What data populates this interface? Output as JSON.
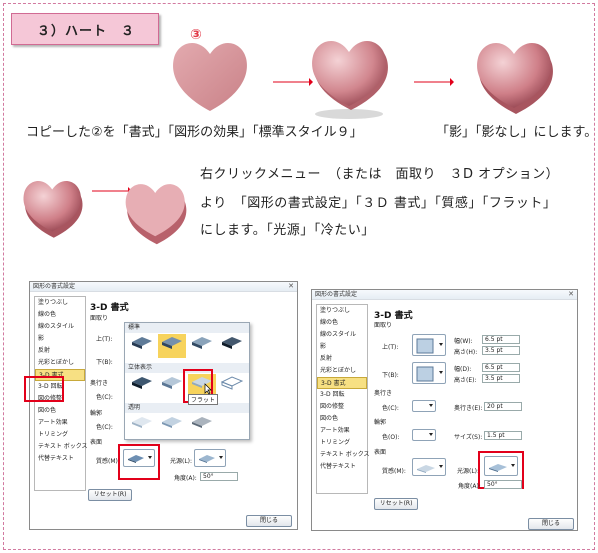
{
  "header": {
    "title": "３）ハート　３"
  },
  "step_marker": "③",
  "captions": {
    "copy": "コピーした②を「書式」「図形の効果」「標準スタイル９」",
    "shadow": "「影」「影なし」にします。"
  },
  "instructions": [
    "右クリックメニュー　（または　面取り　３D オプション）",
    "より　「図形の書式設定」「３Ｄ 書式」「質感」「フラット」",
    "にします。「光源」「冷たい」"
  ],
  "colors": {
    "heart_flat": "#d99aa0",
    "heart_dark": "#b85f6b",
    "arrow": "#e2001a",
    "highlight_box": "#e2001a",
    "nav_selected": "#f7e083",
    "header_bg": "#f5c7d7"
  },
  "dialog_left": {
    "title": "図形の書式設定",
    "close": "✕",
    "nav_items": [
      "塗りつぶし",
      "線の色",
      "線のスタイル",
      "影",
      "反射",
      "光彩とぼかし",
      "3-D 書式",
      "3-D 回転",
      "図の修整",
      "図の色",
      "アート効果",
      "トリミング",
      "テキスト ボックス",
      "代替テキスト"
    ],
    "heading": "3-D 書式",
    "section_bevel": "面取り",
    "label_top": "上(T):",
    "label_bottom": "下(B):",
    "section_depth": "奥行き",
    "label_color": "色(C):",
    "section_contour": "輪郭",
    "section_surface": "表面",
    "label_material": "質感(M):",
    "label_light": "光源(L):",
    "label_angle": "角度(A):",
    "angle_value": "50°",
    "reset": "リセット(R)",
    "close_button": "閉じる",
    "gallery": {
      "standard": "標準",
      "special": "立体表示",
      "translucent": "透明",
      "tooltip": "フラット"
    }
  },
  "dialog_right": {
    "title": "図形の書式設定",
    "close": "✕",
    "nav_items": [
      "塗りつぶし",
      "線の色",
      "線のスタイル",
      "影",
      "反射",
      "光彩とぼかし",
      "3-D 書式",
      "3-D 回転",
      "図の修整",
      "図の色",
      "アート効果",
      "トリミング",
      "テキスト ボックス",
      "代替テキスト"
    ],
    "heading": "3-D 書式",
    "section_bevel": "面取り",
    "label_top": "上(T):",
    "label_bottom": "下(B):",
    "width_label": "幅(W):",
    "height_label": "高さ(H):",
    "width_label_b": "幅(D):",
    "height_label_b": "高さ(E):",
    "top_width": "6.5 pt",
    "top_height": "3.5 pt",
    "bottom_width": "6.5 pt",
    "bottom_height": "3.5 pt",
    "section_depth": "奥行き",
    "label_color": "色(C):",
    "depth_label": "奥行き(E):",
    "depth_value": "20 pt",
    "section_contour": "輪郭",
    "label_color2": "色(O):",
    "size_label": "サイズ(S):",
    "size_value": "1.5 pt",
    "section_surface": "表面",
    "label_material": "質感(M):",
    "label_light": "光源(L):",
    "label_angle": "角度(A):",
    "angle_value": "50°",
    "reset": "リセット(R)",
    "close_button": "閉じる"
  }
}
